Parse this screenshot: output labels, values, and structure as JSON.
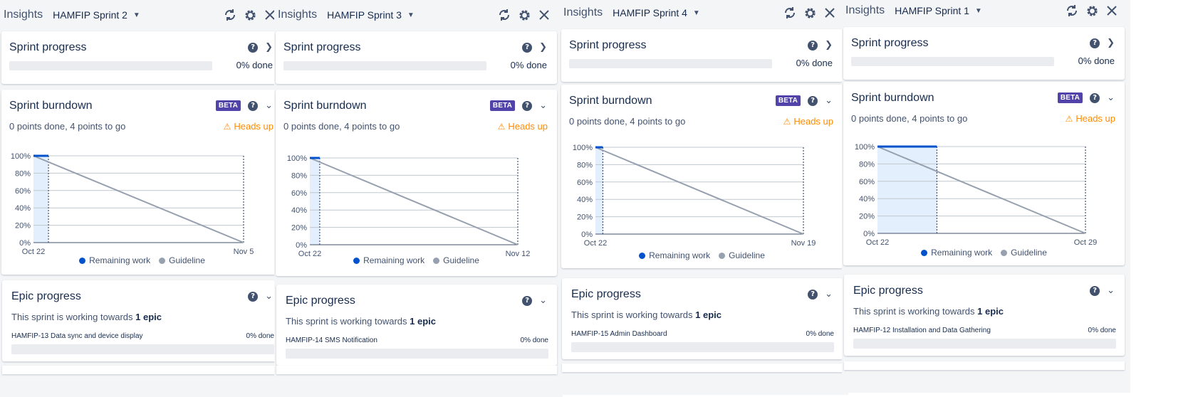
{
  "colors": {
    "remaining": "#0052cc",
    "guideline": "#97a0af",
    "beta": "#5243aa",
    "heads_up": "#ff8b00",
    "panel_bg": "#f4f5f7",
    "track": "#ebecf0",
    "done_band": "#e3effd"
  },
  "panels": [
    {
      "header": {
        "insights": "Insights",
        "sprint": "HAMFIP Sprint 2"
      },
      "sprint_progress": {
        "title": "Sprint progress",
        "percent_label": "0% done",
        "done": 0
      },
      "burndown": {
        "title": "Sprint burndown",
        "badge": "BETA",
        "summary": "0 points done, 4 points to go",
        "heads_up": "Heads up",
        "legend": [
          "Remaining work",
          "Guideline"
        ],
        "chart_data": {
          "type": "line",
          "x_start_label": "Oct 22",
          "x_end_label": "Nov 5",
          "y_ticks": [
            "100%",
            "80%",
            "60%",
            "40%",
            "20%",
            "0%"
          ],
          "ylim": [
            0,
            100
          ],
          "total_days": 14,
          "elapsed_days": 1,
          "series": [
            {
              "name": "Remaining work",
              "values": [
                100,
                100
              ]
            },
            {
              "name": "Guideline",
              "values": [
                100,
                0
              ]
            }
          ]
        }
      },
      "epic_progress": {
        "title": "Epic progress",
        "sub_prefix": "This sprint is working towards ",
        "sub_bold": "1 epic",
        "epic_name": "HAMFIP-13 Data sync and device display",
        "epic_percent": "0% done"
      }
    },
    {
      "header": {
        "insights": "Insights",
        "sprint": "HAMFIP Sprint 3"
      },
      "sprint_progress": {
        "title": "Sprint progress",
        "percent_label": "0% done",
        "done": 0
      },
      "burndown": {
        "title": "Sprint burndown",
        "badge": "BETA",
        "summary": "0 points done, 4 points to go",
        "heads_up": "Heads up",
        "legend": [
          "Remaining work",
          "Guideline"
        ],
        "chart_data": {
          "type": "line",
          "x_start_label": "Oct 22",
          "x_end_label": "Nov 12",
          "y_ticks": [
            "100%",
            "80%",
            "60%",
            "40%",
            "20%",
            "0%"
          ],
          "ylim": [
            0,
            100
          ],
          "total_days": 21,
          "elapsed_days": 1,
          "series": [
            {
              "name": "Remaining work",
              "values": [
                100,
                100
              ]
            },
            {
              "name": "Guideline",
              "values": [
                100,
                0
              ]
            }
          ]
        }
      },
      "epic_progress": {
        "title": "Epic progress",
        "sub_prefix": "This sprint is working towards ",
        "sub_bold": "1 epic",
        "epic_name": "HAMFIP-14 SMS Notification",
        "epic_percent": "0% done"
      }
    },
    {
      "header": {
        "insights": "Insights",
        "sprint": "HAMFIP Sprint 4"
      },
      "sprint_progress": {
        "title": "Sprint progress",
        "percent_label": "0% done",
        "done": 0
      },
      "burndown": {
        "title": "Sprint burndown",
        "badge": "BETA",
        "summary": "0 points done, 4 points to go",
        "heads_up": "Heads up",
        "legend": [
          "Remaining work",
          "Guideline"
        ],
        "chart_data": {
          "type": "line",
          "x_start_label": "Oct 22",
          "x_end_label": "Nov 19",
          "y_ticks": [
            "100%",
            "80%",
            "60%",
            "40%",
            "20%",
            "0%"
          ],
          "ylim": [
            0,
            100
          ],
          "total_days": 28,
          "elapsed_days": 1,
          "series": [
            {
              "name": "Remaining work",
              "values": [
                100,
                100
              ]
            },
            {
              "name": "Guideline",
              "values": [
                100,
                0
              ]
            }
          ]
        }
      },
      "epic_progress": {
        "title": "Epic progress",
        "sub_prefix": "This sprint is working towards ",
        "sub_bold": "1 epic",
        "epic_name": "HAMFIP-15 Admin Dashboard",
        "epic_percent": "0% done"
      }
    },
    {
      "header": {
        "insights": "Insights",
        "sprint": "HAMFIP Sprint 1"
      },
      "sprint_progress": {
        "title": "Sprint progress",
        "percent_label": "0% done",
        "done": 0
      },
      "burndown": {
        "title": "Sprint burndown",
        "badge": "BETA",
        "summary": "0 points done, 4 points to go",
        "heads_up": "Heads up",
        "legend": [
          "Remaining work",
          "Guideline"
        ],
        "chart_data": {
          "type": "line",
          "x_start_label": "Oct 22",
          "x_end_label": "Oct 29",
          "y_ticks": [
            "100%",
            "80%",
            "60%",
            "40%",
            "20%",
            "0%"
          ],
          "ylim": [
            0,
            100
          ],
          "total_days": 7,
          "elapsed_days": 2,
          "series": [
            {
              "name": "Remaining work",
              "values": [
                100,
                100
              ]
            },
            {
              "name": "Guideline",
              "values": [
                100,
                0
              ]
            }
          ]
        }
      },
      "epic_progress": {
        "title": "Epic progress",
        "sub_prefix": "This sprint is working towards ",
        "sub_bold": "1 epic",
        "epic_name": "HAMFIP-12 Installation and Data Gathering",
        "epic_percent": "0% done"
      }
    }
  ]
}
